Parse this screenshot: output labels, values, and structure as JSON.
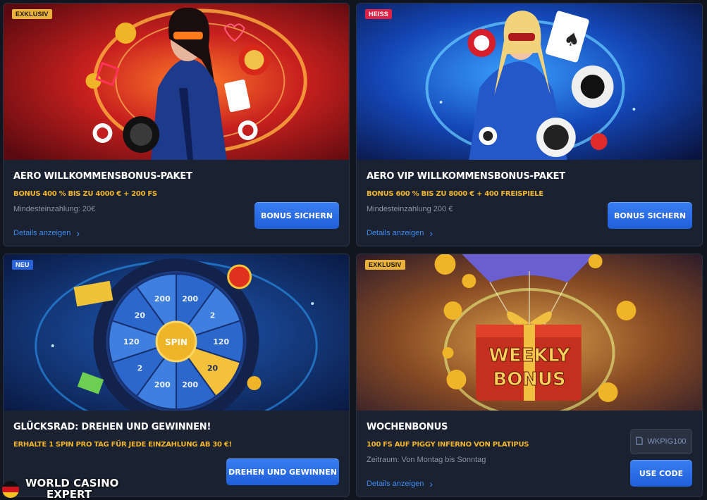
{
  "cards": [
    {
      "badge": "EXKLUSIV",
      "title": "AERO WILLKOMMENSBONUS-PAKET",
      "subtitle": "BONUS 400 % BIS ZU 4000 € + 200 FS",
      "meta": "Mindesteinzahlung: 20€",
      "details": "Details anzeigen",
      "button": "BONUS SICHERN"
    },
    {
      "badge": "HEISS",
      "title": "AERO VIP WILLKOMMENSBONUS-PAKET",
      "subtitle": "BONUS 600 % BIS ZU 8000 € + 400 FREISPIELE",
      "meta": "Mindesteinzahlung 200 €",
      "details": "Details anzeigen",
      "button": "BONUS SICHERN"
    },
    {
      "badge": "NEU",
      "title": "GLÜCKSRAD: DREHEN UND GEWINNEN!",
      "subtitle": "ERHALTE 1 SPIN PRO TAG FÜR JEDE EINZAHLUNG AB 30 €!",
      "button": "DREHEN UND GEWINNEN",
      "wheel": {
        "center": "SPIN",
        "segments": [
          "200",
          "2",
          "120",
          "20",
          "200",
          "200",
          "2",
          "120",
          "20",
          "200"
        ]
      }
    },
    {
      "badge": "EXKLUSIV",
      "title": "WOCHENBONUS",
      "subtitle": "100 FS AUF PIGGY INFERNO VON PLATIPUS",
      "meta": "Zeitraum: Von Montag bis Sonntag",
      "details": "Details anzeigen",
      "code": "WKPIG100",
      "button": "USE CODE",
      "gift_line1": "WEEKLY",
      "gift_line2": "BONUS"
    }
  ],
  "watermark": {
    "line1": "WORLD CASINO",
    "line2": "EXPERT"
  },
  "colors": {
    "accent_blue": "#2a6fe8",
    "highlight_gold": "#f1b52e",
    "card_bg": "#1a2130"
  }
}
